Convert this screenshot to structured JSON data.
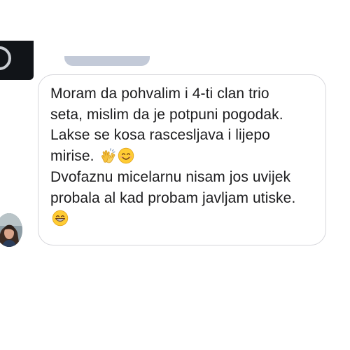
{
  "conversation": {
    "message": {
      "lines": [
        "Moram da pohvalim i 4-ti clan trio",
        "seta, mislim da je potpuni pogodak.",
        "Lakse se kosa rascesljava i lijepo",
        "mirise.",
        "Dvofaznu micelarnu nisam jos uvijek",
        "probala al kad probam javljam utiske."
      ],
      "emojis": [
        "clapping-hands-icon",
        "smiling-face-icon",
        "grinning-face-icon"
      ]
    }
  },
  "colors": {
    "bubble_border": "#d6d6db",
    "text": "#1c1c1e",
    "previous_bubble": "#c3cad8"
  }
}
